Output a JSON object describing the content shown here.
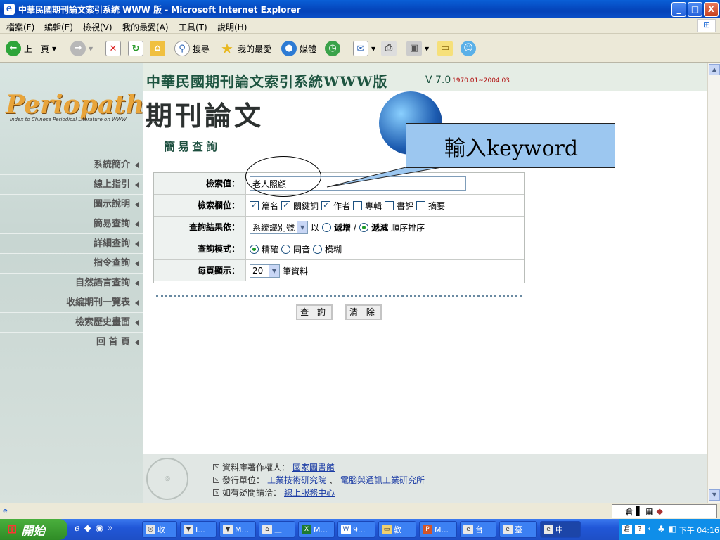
{
  "window": {
    "title": "中華民國期刊論文索引系統 WWW 版 - Microsoft Internet Explorer",
    "controls": {
      "minimize": "_",
      "maximize": "□",
      "close": "X"
    }
  },
  "menubar": [
    "檔案(F)",
    "編輯(E)",
    "檢視(V)",
    "我的最愛(A)",
    "工具(T)",
    "說明(H)"
  ],
  "toolbar": {
    "back": "上一頁",
    "search": "搜尋",
    "favorites": "我的最愛",
    "media": "媒體"
  },
  "sidebar": {
    "logo": "Periopath",
    "logo_sub": "Index to Chinese Periodical Literature on WWW",
    "items": [
      "系統簡介",
      "線上指引",
      "圖示說明",
      "簡易查詢",
      "詳細查詢",
      "指令查詢",
      "自然語言查詢",
      "收編期刊一覽表",
      "檢索歷史畫面",
      "回 首 頁"
    ]
  },
  "banner": {
    "title": "中華民國期刊論文索引系統WWW版",
    "version": "V 7.0",
    "range": "1970.01~2004.03",
    "calligraphy": "期刊論文"
  },
  "page": {
    "heading": "簡易查詢"
  },
  "form": {
    "keyword_label": "檢索值：",
    "keyword_value": "老人照顧",
    "fields_label": "檢索欄位：",
    "fields": [
      {
        "label": "篇名",
        "checked": true
      },
      {
        "label": "關鍵詞",
        "checked": true
      },
      {
        "label": "作者",
        "checked": true
      },
      {
        "label": "專輯",
        "checked": false
      },
      {
        "label": "書評",
        "checked": false
      },
      {
        "label": "摘要",
        "checked": false
      }
    ],
    "sort_label": "查詢結果依：",
    "sort_select": "系統識別號",
    "sort_by": "以",
    "sort_asc": "遞增",
    "sort_slash": "/",
    "sort_desc": "遞減",
    "sort_suffix": "順序排序",
    "mode_label": "查詢模式：",
    "modes": [
      {
        "label": "精確",
        "selected": true
      },
      {
        "label": "同音",
        "selected": false
      },
      {
        "label": "模糊",
        "selected": false
      }
    ],
    "per_page_label": "每頁顯示：",
    "per_page_value": "20",
    "per_page_suffix": "筆資料",
    "search_button": "查 詢",
    "clear_button": "清 除"
  },
  "callout": "輸入keyword",
  "footer": {
    "line1_label": "資料庫著作權人：",
    "line1_link": "國家圖書館",
    "line2_label": "發行單位：",
    "line2_link1": "工業技術研究院",
    "line2_sep": "、",
    "line2_link2": "電腦與通訊工業研究所",
    "line3_label": "如有疑問請洽：",
    "line3_link": "線上服務中心"
  },
  "taskbar": {
    "start": "開始",
    "tasks": [
      "收",
      "I...",
      "M...",
      "工",
      "M...",
      "9...",
      "教",
      "M...",
      "台",
      "臺",
      "中"
    ],
    "tray_ime": "倉",
    "clock": "下午 04:16"
  },
  "colors": {
    "accent": "#1d5440",
    "callout": "#9cc7f0",
    "link": "#1a3ba4"
  }
}
